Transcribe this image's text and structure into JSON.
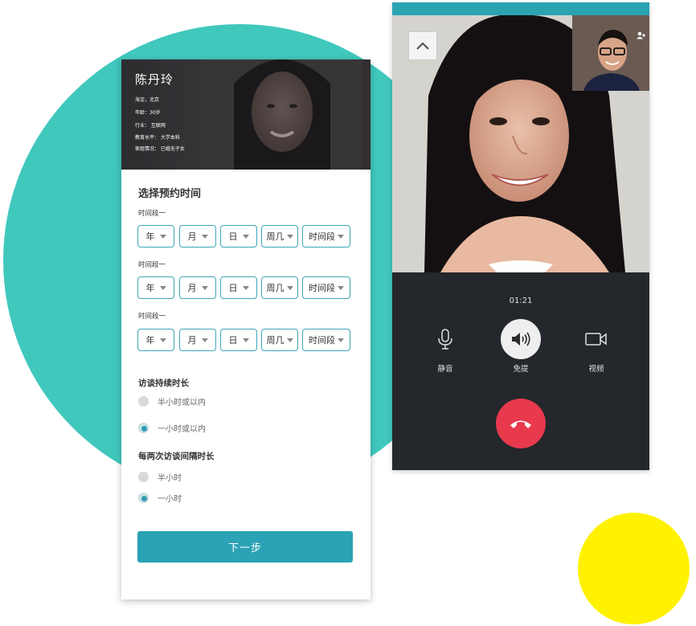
{
  "profile": {
    "name": "陈丹玲",
    "location": "海淀，北京",
    "age": "年龄：30岁",
    "industry": "行业：  互联网",
    "education": "教育水平：  大学本科",
    "family": "家庭情况：  已婚无子女"
  },
  "form": {
    "title": "选择预约时间",
    "slots": [
      {
        "label": "时间段一",
        "year": "年",
        "month": "月",
        "day": "日",
        "weekday": "周几",
        "period": "时间段"
      },
      {
        "label": "时间段一",
        "year": "年",
        "month": "月",
        "day": "日",
        "weekday": "周几",
        "period": "时间段"
      },
      {
        "label": "时间段一",
        "year": "年",
        "month": "月",
        "day": "日",
        "weekday": "周几",
        "period": "时间段"
      }
    ],
    "duration": {
      "title": "访谈持续时长",
      "options": [
        {
          "label": "半小时或以内",
          "checked": false
        },
        {
          "label": "一小时或以内",
          "checked": true
        }
      ]
    },
    "interval": {
      "title": "每两次访谈间隔时长",
      "options": [
        {
          "label": "半小时",
          "checked": false
        },
        {
          "label": "一小时",
          "checked": true
        }
      ]
    },
    "next_label": "下一步"
  },
  "call": {
    "timer": "01:21",
    "mute_label": "静音",
    "speaker_label": "免提",
    "video_label": "视频"
  },
  "colors": {
    "teal": "#40c8bd",
    "accent": "#2ba2b5",
    "yellow": "#fff200",
    "hangup": "#e8394d"
  },
  "icons": [
    "chevron-up-icon",
    "add-user-icon",
    "microphone-icon",
    "speaker-icon",
    "video-camera-icon",
    "hang-up-icon",
    "caret-down-icon"
  ]
}
